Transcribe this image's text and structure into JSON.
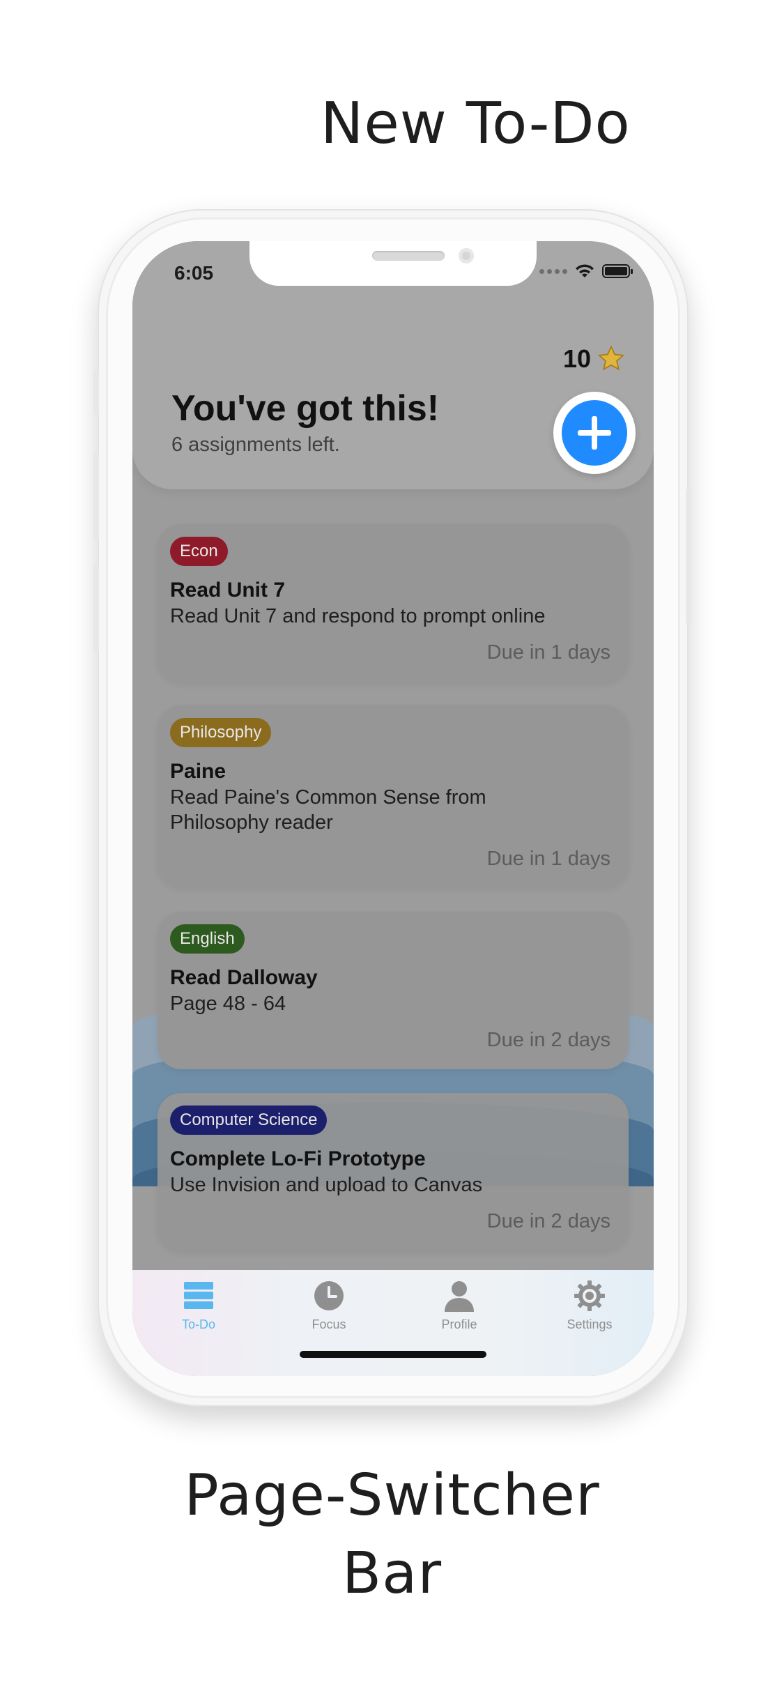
{
  "captions": {
    "top": "New To-Do",
    "bottom_line1": "Page-Switcher",
    "bottom_line2": "Bar"
  },
  "status_bar": {
    "time": "6:05"
  },
  "header": {
    "star_count": "10",
    "title": "You've got this!",
    "subtitle": "6 assignments left.",
    "add_button_color": "#1f8bff"
  },
  "assignments": [
    {
      "tag": "Econ",
      "tag_color": "#8e1a2a",
      "title": "Read Unit 7",
      "desc": "Read Unit 7 and respond to prompt online",
      "due": "Due in 1 days"
    },
    {
      "tag": "Philosophy",
      "tag_color": "#8b6b1e",
      "title": "Paine",
      "desc": "Read Paine's Common Sense from Philosophy reader",
      "due": "Due in 1 days"
    },
    {
      "tag": "English",
      "tag_color": "#2d5a1e",
      "title": "Read Dalloway",
      "desc": "Page 48 - 64",
      "due": "Due in 2 days"
    },
    {
      "tag": "Computer Science",
      "tag_color": "#1c1f6b",
      "title": "Complete Lo-Fi Prototype",
      "desc": "Use Invision and upload to Canvas",
      "due": "Due in 2 days"
    }
  ],
  "tabs": [
    {
      "label": "To-Do",
      "icon": "list-icon",
      "active": true
    },
    {
      "label": "Focus",
      "icon": "clock-icon",
      "active": false
    },
    {
      "label": "Profile",
      "icon": "person-icon",
      "active": false
    },
    {
      "label": "Settings",
      "icon": "gear-icon",
      "active": false
    }
  ],
  "colors": {
    "active_tab": "#5ab6ef",
    "inactive_tab": "#8f8f8f"
  }
}
